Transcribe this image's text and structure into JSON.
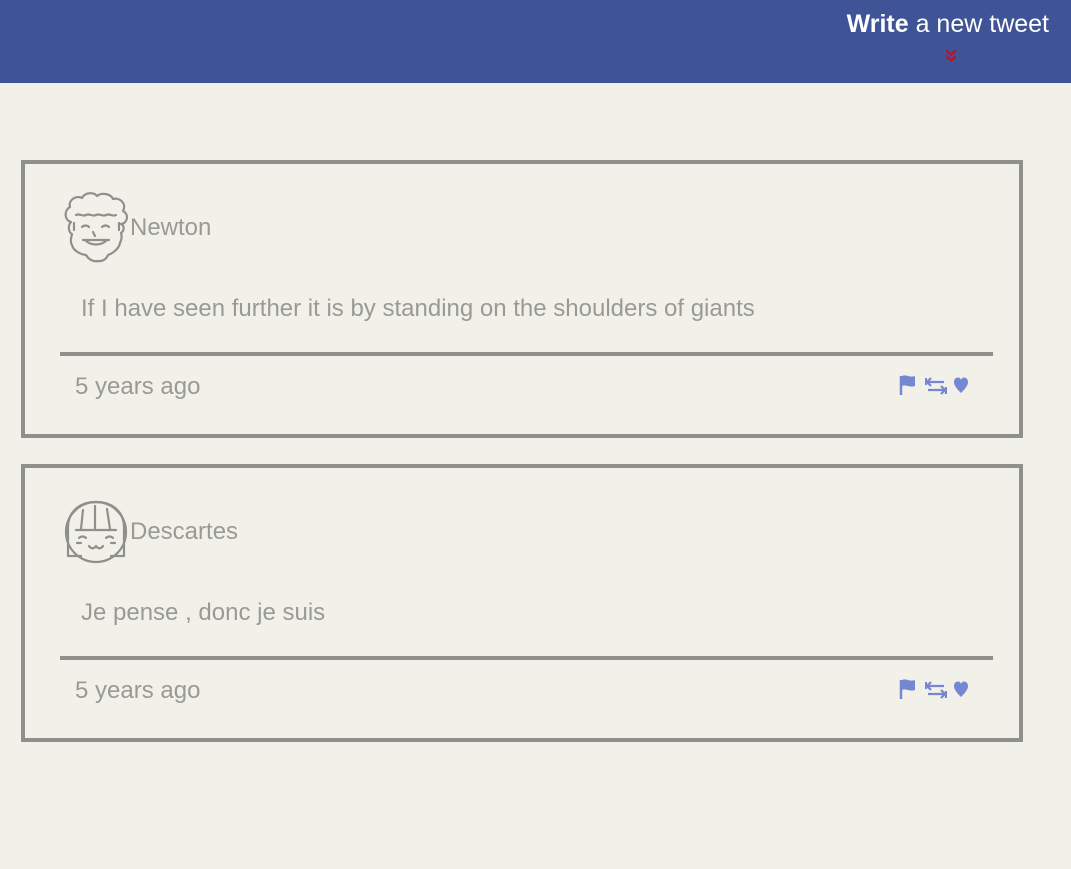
{
  "header": {
    "compose_strong": "Write",
    "compose_rest": " a new tweet",
    "toggle_icon": "double-chevron-down-icon",
    "accent_color": "#3f5397",
    "toggle_color": "#c0102a"
  },
  "tweets": [
    {
      "author": "Newton",
      "avatar_icon": "curly-hair-face-icon",
      "content": "If I have seen further it is by standing on the shoulders of giants",
      "timestamp": "5 years ago",
      "actions": [
        "flag-icon",
        "retweet-icon",
        "heart-icon"
      ]
    },
    {
      "author": "Descartes",
      "avatar_icon": "bob-hair-face-icon",
      "content": "Je pense , donc je suis",
      "timestamp": "5 years ago",
      "actions": [
        "flag-icon",
        "retweet-icon",
        "heart-icon"
      ]
    }
  ],
  "colors": {
    "background": "#f2f1e9",
    "border": "#8f8f8b",
    "text": "#9a9a95",
    "action_icon": "#7586d2"
  }
}
